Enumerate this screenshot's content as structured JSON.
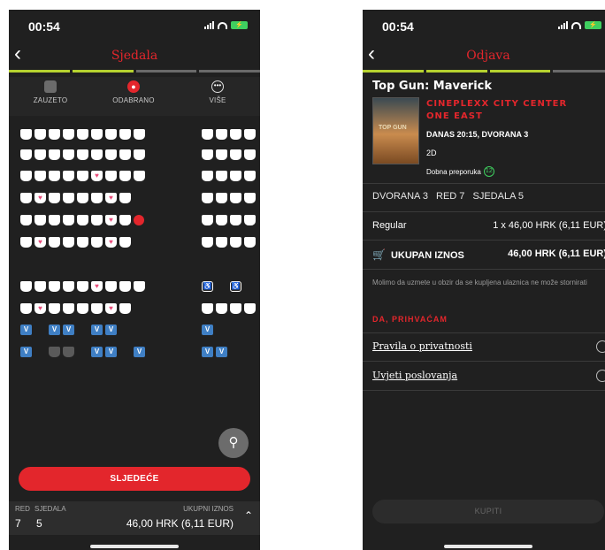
{
  "left": {
    "status": {
      "time": "00:54"
    },
    "nav": {
      "title": "Sjedala"
    },
    "legend": {
      "taken": "ZAUZETO",
      "chosen": "ODABRANO",
      "more": "VIŠE"
    },
    "seat_symbols": {
      "heart": "♥",
      "vip": "V",
      "wheelchair": "♿"
    },
    "next_button": "SLJEDEĆE",
    "summary": {
      "row_header": "RED",
      "seats_header": "SJEDALA",
      "total_header": "UKUPNI IZNOS",
      "row_value": "7",
      "seats_value": "5",
      "total_value": "46,00 HRK (6,11 EUR)"
    }
  },
  "right": {
    "status": {
      "time": "00:54"
    },
    "nav": {
      "title": "Odjava"
    },
    "movie": {
      "title": "Top Gun: Maverick",
      "poster_text": "TOP GUN",
      "cinema": "CINEPLEXX CITY CENTER ONE EAST",
      "showtime": "DANAS 20:15, DVORANA 3",
      "format": "2D",
      "rating_label": "Dobna preporuka",
      "rating_value": "12"
    },
    "seat_info": {
      "hall": "DVORANA 3",
      "row": "RED 7",
      "seats": "SJEDALA 5"
    },
    "ticket": {
      "type": "Regular",
      "price": "1 x 46,00 HRK (6,11 EUR)"
    },
    "total": {
      "label": "UKUPAN IZNOS",
      "value": "46,00 HRK (6,11 EUR)"
    },
    "note": "Molimo da uzmete u obzir da se kupljena ulaznica ne može stornirati",
    "accept": "DA, PRIHVAĆAM",
    "links": {
      "privacy": "Pravila o privatnosti",
      "terms": "Uvjeti poslovanja"
    },
    "pay_button": "KUPITI"
  }
}
